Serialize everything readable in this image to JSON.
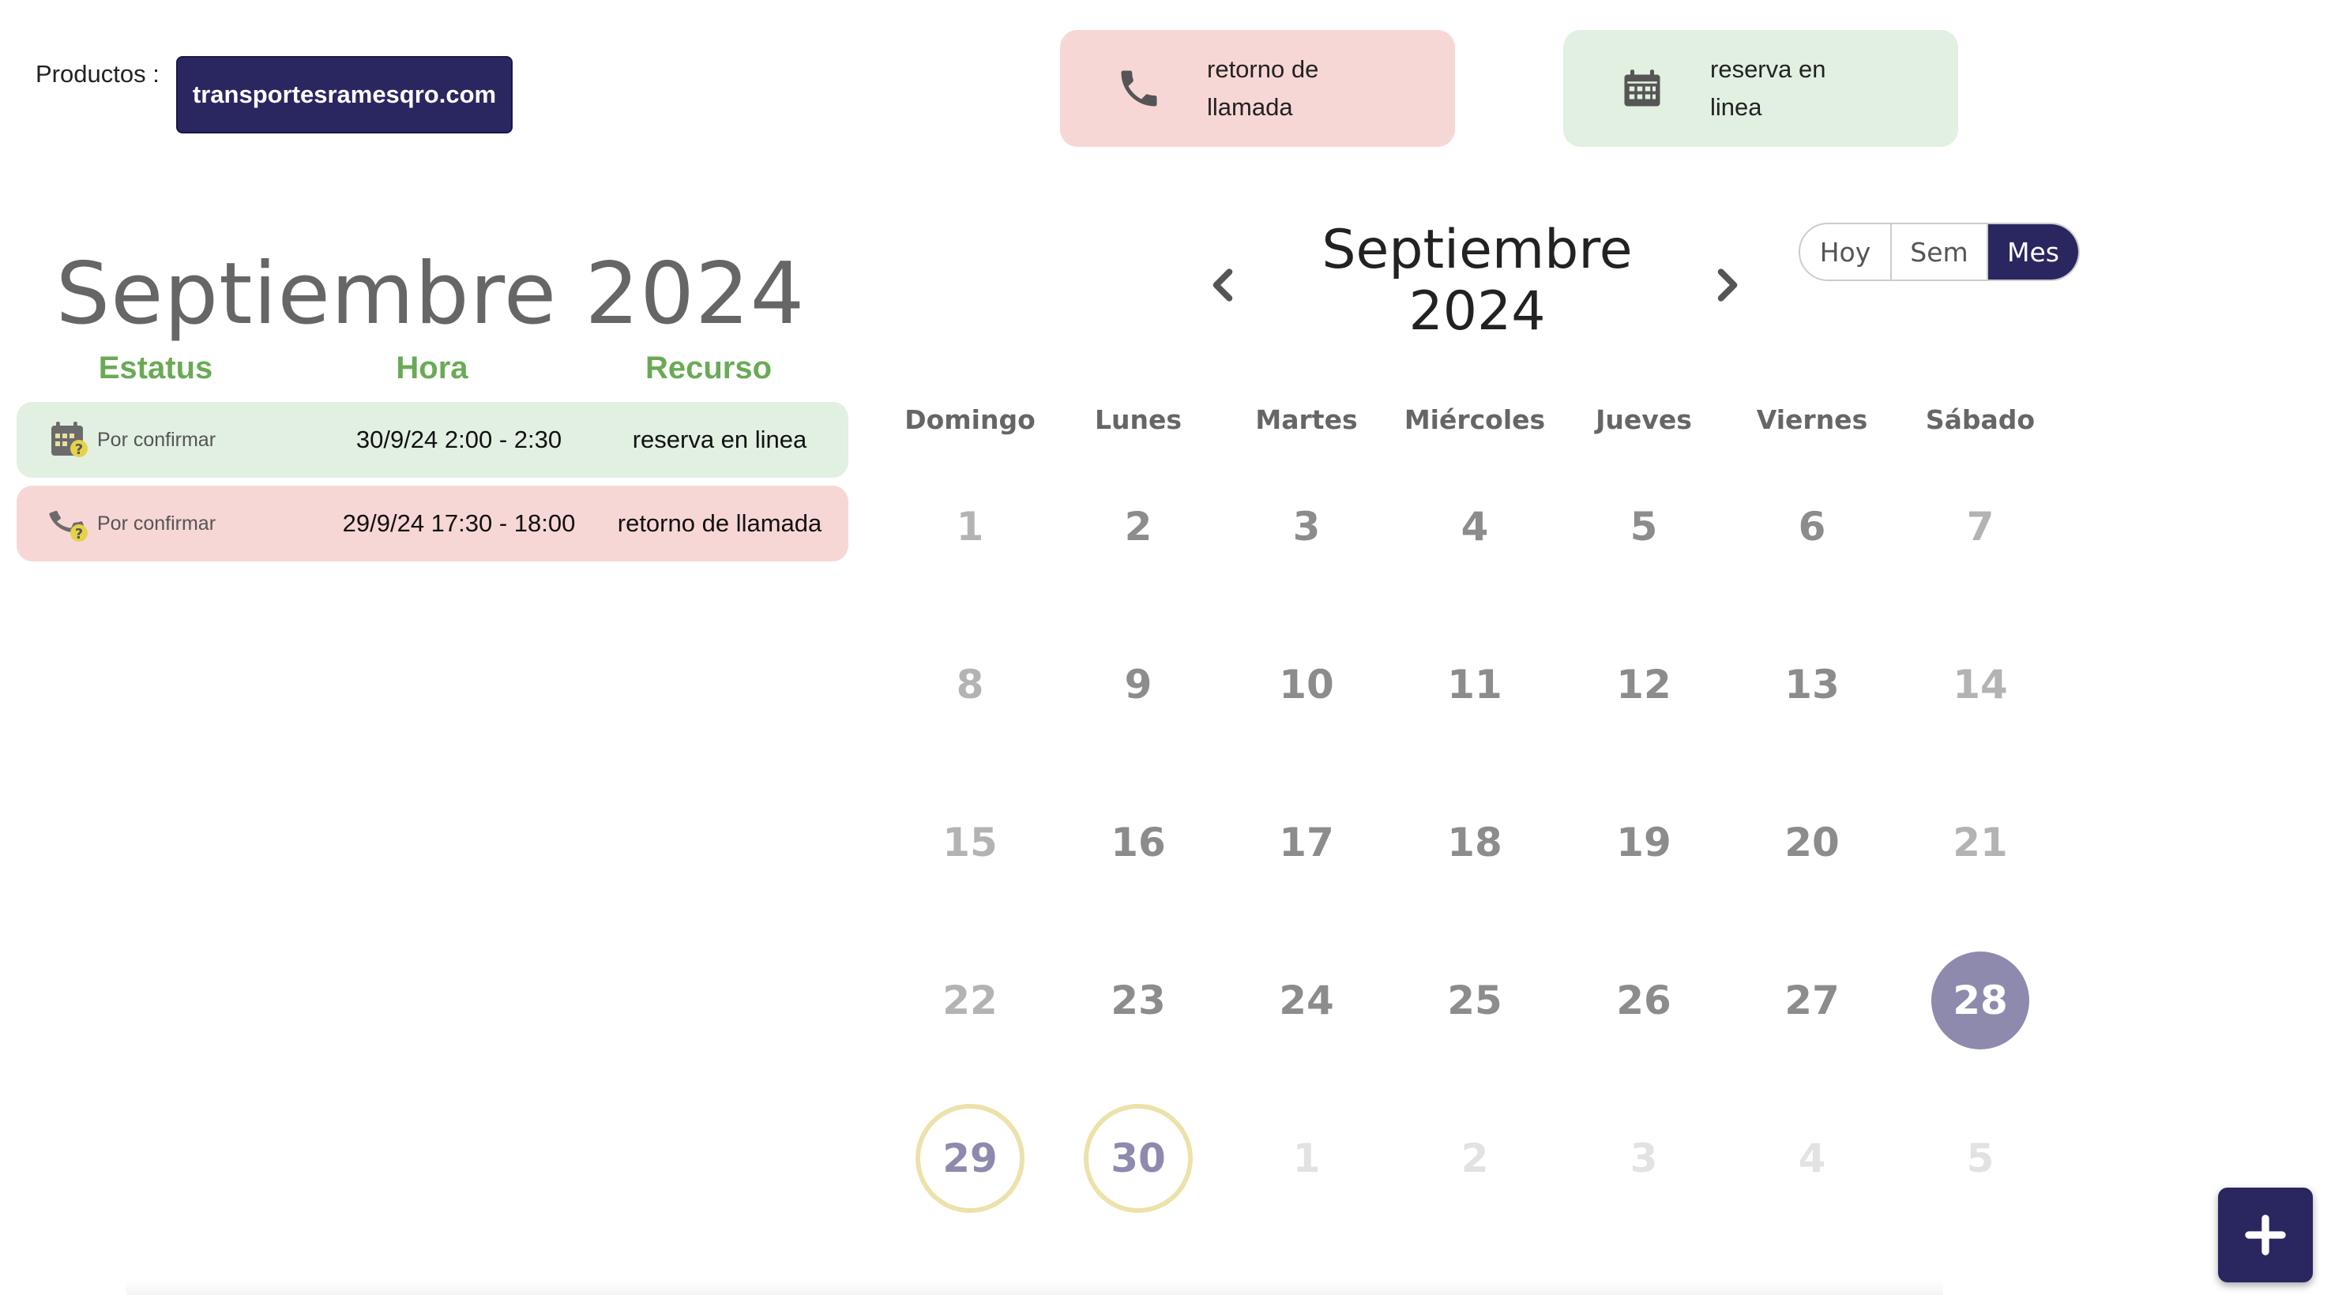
{
  "header": {
    "products_label": "Productos :",
    "products_button": "transportesramesqro.com",
    "quick_call_label": "retorno de llamada",
    "quick_book_label": "reserva en linea"
  },
  "list": {
    "title": "Septiembre 2024",
    "columns": [
      "Estatus",
      "Hora",
      "Recurso"
    ],
    "rows": [
      {
        "status": "Por confirmar",
        "time": "30/9/24 2:00 - 2:30",
        "resource": "reserva en linea",
        "icon": "calendar-icon",
        "color": "#e1f0e0"
      },
      {
        "status": "Por confirmar",
        "time": "29/9/24 17:30 - 18:00",
        "resource": "retorno de llamada",
        "icon": "phone-icon",
        "color": "#f7d7d5"
      }
    ]
  },
  "calendar": {
    "month_line1": "Septiembre",
    "month_line2": "2024",
    "views": [
      "Hoy",
      "Sem",
      "Mes"
    ],
    "active_view": "Mes",
    "weekdays": [
      "Domingo",
      "Lunes",
      "Martes",
      "Miércoles",
      "Jueves",
      "Viernes",
      "Sábado"
    ],
    "weeks": [
      [
        "1",
        "2",
        "3",
        "4",
        "5",
        "6",
        "7"
      ],
      [
        "8",
        "9",
        "10",
        "11",
        "12",
        "13",
        "14"
      ],
      [
        "15",
        "16",
        "17",
        "18",
        "19",
        "20",
        "21"
      ],
      [
        "22",
        "23",
        "24",
        "25",
        "26",
        "27",
        "28"
      ],
      [
        "29",
        "30",
        "1",
        "2",
        "3",
        "4",
        "5"
      ]
    ],
    "selected_day": "28",
    "event_days": [
      "29",
      "30"
    ]
  },
  "colors": {
    "accent": "#2a2660",
    "header_green": "#6aaa55",
    "row_green": "#e1f0e0",
    "row_red": "#f7d7d5",
    "event_ring": "#ece2aa",
    "selected_day": "#8e8aae"
  },
  "icons": {
    "quick_call": "phone-icon",
    "quick_book": "calendar-icon",
    "prev": "chevron-left-icon",
    "next": "chevron-right-icon",
    "fab": "plus-icon"
  }
}
